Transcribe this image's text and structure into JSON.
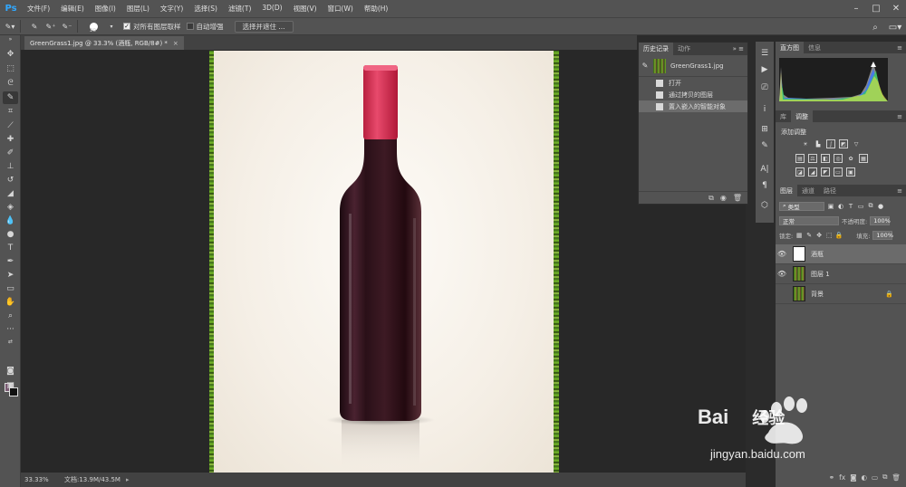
{
  "app": {
    "logo": "Ps",
    "menus": [
      "文件(F)",
      "编辑(E)",
      "图像(I)",
      "图层(L)",
      "文字(Y)",
      "选择(S)",
      "滤镜(T)",
      "3D(D)",
      "视图(V)",
      "窗口(W)",
      "帮助(H)"
    ]
  },
  "options_bar": {
    "brush_size": "20",
    "sample_all_layers": "对所有图层取样",
    "sample_all_checked": true,
    "auto_enhance": "自动增强",
    "auto_enhance_checked": false,
    "select_mask_button": "选择并遮住 ..."
  },
  "document": {
    "tab_title": "GreenGrass1.jpg @ 33.3% (酒瓶, RGB/8#) *",
    "zoom": "33.33%",
    "doc_info": "文档:13.9M/43.5M"
  },
  "colors": {
    "foreground": "#7a5a73",
    "background": "#111111",
    "bottle_cap": "#e03a5c",
    "bottle_body": "#3a1a22"
  },
  "history_panel": {
    "tabs": [
      "历史记录",
      "动作"
    ],
    "snapshot": "GreenGrass1.jpg",
    "items": [
      "打开",
      "通过拷贝的图层",
      "置入嵌入的智能对象"
    ],
    "selected_index": 2
  },
  "histogram_panel": {
    "tabs": [
      "直方图",
      "信息"
    ]
  },
  "adjustments_panel": {
    "tabs": [
      "库",
      "调整"
    ],
    "title": "添加调整"
  },
  "layers_panel": {
    "tabs": [
      "图层",
      "通道",
      "路径"
    ],
    "filter_kind": "类型",
    "blend_mode": "正常",
    "opacity_label": "不透明度:",
    "opacity_value": "100%",
    "lock_label": "锁定:",
    "fill_label": "填充:",
    "fill_value": "100%",
    "layers": [
      {
        "name": "酒瓶",
        "visible": true,
        "selected": true,
        "thumb": "white",
        "locked": false
      },
      {
        "name": "图层 1",
        "visible": true,
        "selected": false,
        "thumb": "grass",
        "locked": false
      },
      {
        "name": "背景",
        "visible": false,
        "selected": false,
        "thumb": "grass",
        "locked": true
      }
    ]
  },
  "watermark": {
    "brand": "Bai",
    "brand_cn": "经验",
    "url": "jingyan.baidu.com"
  }
}
